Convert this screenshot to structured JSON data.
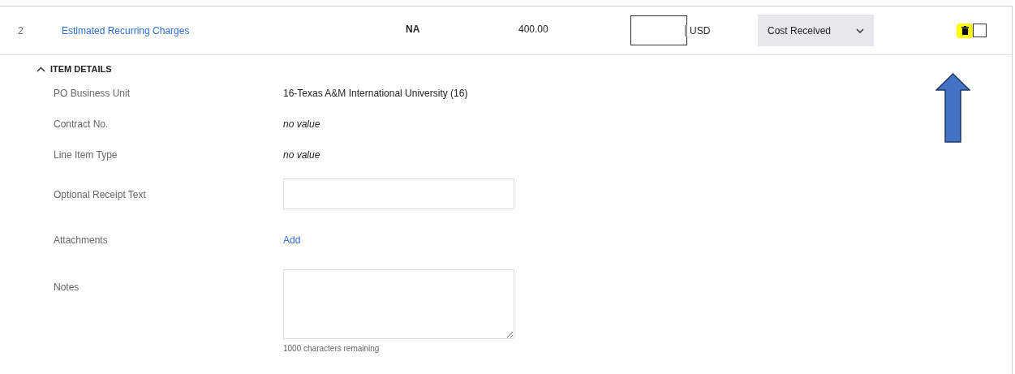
{
  "line": {
    "number": "2",
    "item_link": "Estimated Recurring Charges",
    "column_3": "NA",
    "column_4": "400.00",
    "currency": "USD",
    "status_select": {
      "value": "Cost Received"
    },
    "delete_highlighted": true,
    "checked": false
  },
  "details": {
    "title": "ITEM DETAILS",
    "expanded": true,
    "fields": [
      {
        "kind": "text",
        "label": "PO Business Unit",
        "value": "16-Texas A&M International University (16)"
      },
      {
        "kind": "empty",
        "label": "Contract No.",
        "value": "no value"
      },
      {
        "kind": "empty",
        "label": "Line Item Type",
        "value": "no value"
      },
      {
        "kind": "input",
        "label": "Optional Receipt Text"
      },
      {
        "kind": "link",
        "label": "Attachments",
        "value": "Add"
      },
      {
        "kind": "textarea",
        "label": "Notes",
        "hint": "1000 characters remaining"
      }
    ]
  }
}
